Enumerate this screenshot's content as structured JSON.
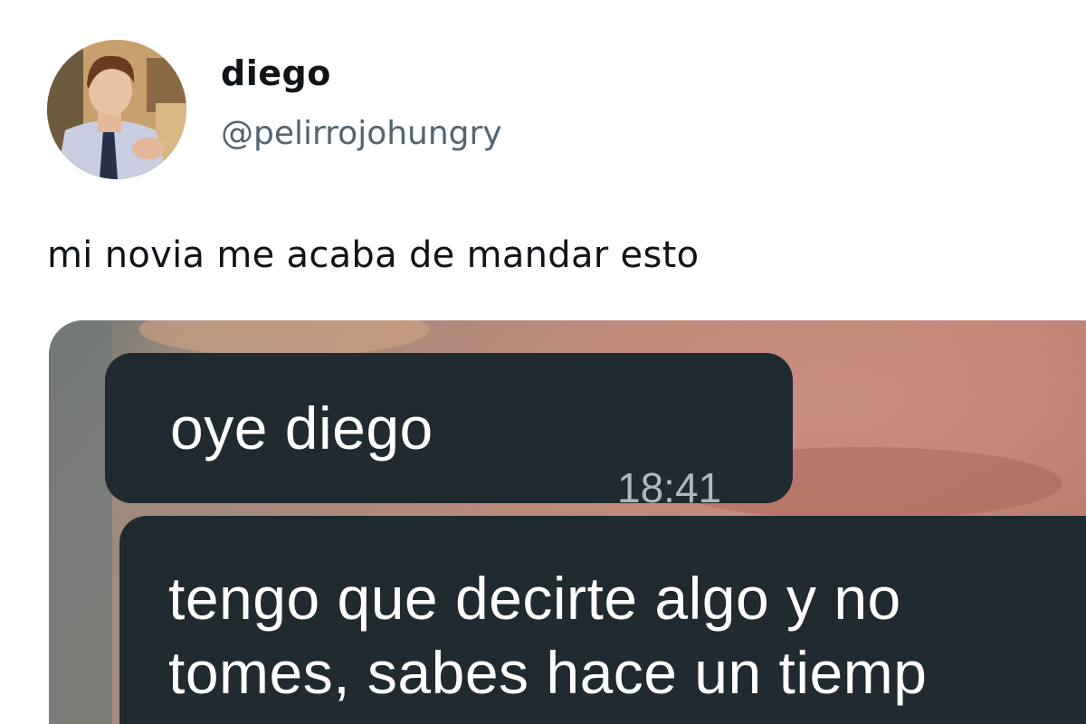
{
  "user": {
    "display_name": "diego",
    "handle": "@pelirrojohungry"
  },
  "tweet": {
    "text": "mi novia me acaba de mandar esto"
  },
  "media": {
    "messages": [
      {
        "text": "oye diego",
        "time": "18:41"
      },
      {
        "line1": "tengo que decirte algo y no",
        "line2": "tomes, sabes hace un tiemp"
      }
    ],
    "bubble_color": "#1f2b30"
  }
}
